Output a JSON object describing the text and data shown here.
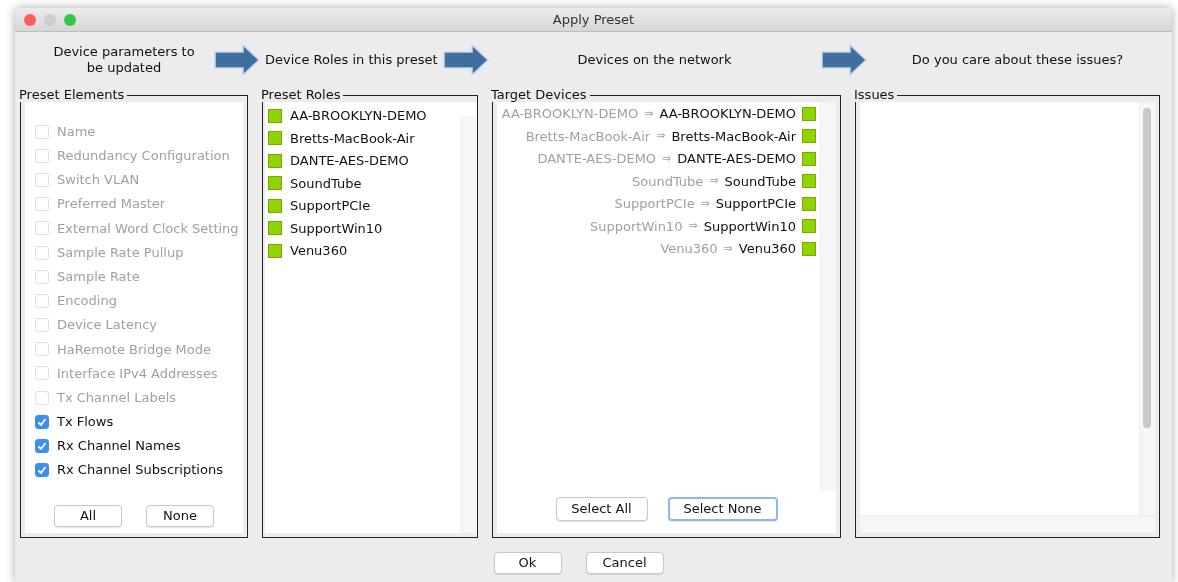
{
  "window": {
    "title": "Apply Preset"
  },
  "steps": [
    "Device parameters to be updated",
    "Device Roles in this preset",
    "Devices on the network",
    "Do you care about these issues?"
  ],
  "preset_elements": {
    "title": "Preset Elements",
    "items": [
      {
        "label": "Name",
        "checked": false,
        "disabled": true
      },
      {
        "label": "Redundancy Configuration",
        "checked": false,
        "disabled": true
      },
      {
        "label": "Switch VLAN",
        "checked": false,
        "disabled": true
      },
      {
        "label": "Preferred Master",
        "checked": false,
        "disabled": true
      },
      {
        "label": "External Word Clock Setting",
        "checked": false,
        "disabled": true
      },
      {
        "label": "Sample Rate Pullup",
        "checked": false,
        "disabled": true
      },
      {
        "label": "Sample Rate",
        "checked": false,
        "disabled": true
      },
      {
        "label": "Encoding",
        "checked": false,
        "disabled": true
      },
      {
        "label": "Device Latency",
        "checked": false,
        "disabled": true
      },
      {
        "label": "HaRemote Bridge Mode",
        "checked": false,
        "disabled": true
      },
      {
        "label": "Interface IPv4 Addresses",
        "checked": false,
        "disabled": true
      },
      {
        "label": "Tx Channel Labels",
        "checked": false,
        "disabled": true
      },
      {
        "label": "Tx Flows",
        "checked": true,
        "disabled": false
      },
      {
        "label": "Rx Channel Names",
        "checked": true,
        "disabled": false
      },
      {
        "label": "Rx Channel Subscriptions",
        "checked": true,
        "disabled": false
      }
    ],
    "buttons": [
      {
        "label": "All",
        "focused": false
      },
      {
        "label": "None",
        "focused": false
      }
    ]
  },
  "preset_roles": {
    "title": "Preset Roles",
    "items": [
      {
        "name": "AA-BROOKLYN-DEMO",
        "color": "#8fd400"
      },
      {
        "name": "Bretts-MacBook-Air",
        "color": "#8fd400"
      },
      {
        "name": "DANTE-AES-DEMO",
        "color": "#8fd400"
      },
      {
        "name": "SoundTube",
        "color": "#8fd400"
      },
      {
        "name": "SupportPCIe",
        "color": "#8fd400"
      },
      {
        "name": "SupportWin10",
        "color": "#8fd400"
      },
      {
        "name": "Venu360",
        "color": "#8fd400"
      }
    ]
  },
  "target_devices": {
    "title": "Target Devices",
    "items": [
      {
        "source": "AA-BROOKLYN-DEMO",
        "arrow": "⇒",
        "target": "AA-BROOKLYN-DEMO",
        "color": "#8fd400"
      },
      {
        "source": "Bretts-MacBook-Air",
        "arrow": "⇒",
        "target": "Bretts-MacBook-Air",
        "color": "#8fd400"
      },
      {
        "source": "DANTE-AES-DEMO",
        "arrow": "⇒",
        "target": "DANTE-AES-DEMO",
        "color": "#8fd400"
      },
      {
        "source": "SoundTube",
        "arrow": "⇒",
        "target": "SoundTube",
        "color": "#8fd400"
      },
      {
        "source": "SupportPCIe",
        "arrow": "⇒",
        "target": "SupportPCIe",
        "color": "#8fd400"
      },
      {
        "source": "SupportWin10",
        "arrow": "⇒",
        "target": "SupportWin10",
        "color": "#8fd400"
      },
      {
        "source": "Venu360",
        "arrow": "⇒",
        "target": "Venu360",
        "color": "#8fd400"
      }
    ],
    "buttons": [
      {
        "label": "Select All",
        "focused": false
      },
      {
        "label": "Select None",
        "focused": true
      }
    ]
  },
  "issues": {
    "title": "Issues"
  },
  "footer_buttons": [
    {
      "label": "Ok",
      "focused": false
    },
    {
      "label": "Cancel",
      "focused": false
    }
  ]
}
